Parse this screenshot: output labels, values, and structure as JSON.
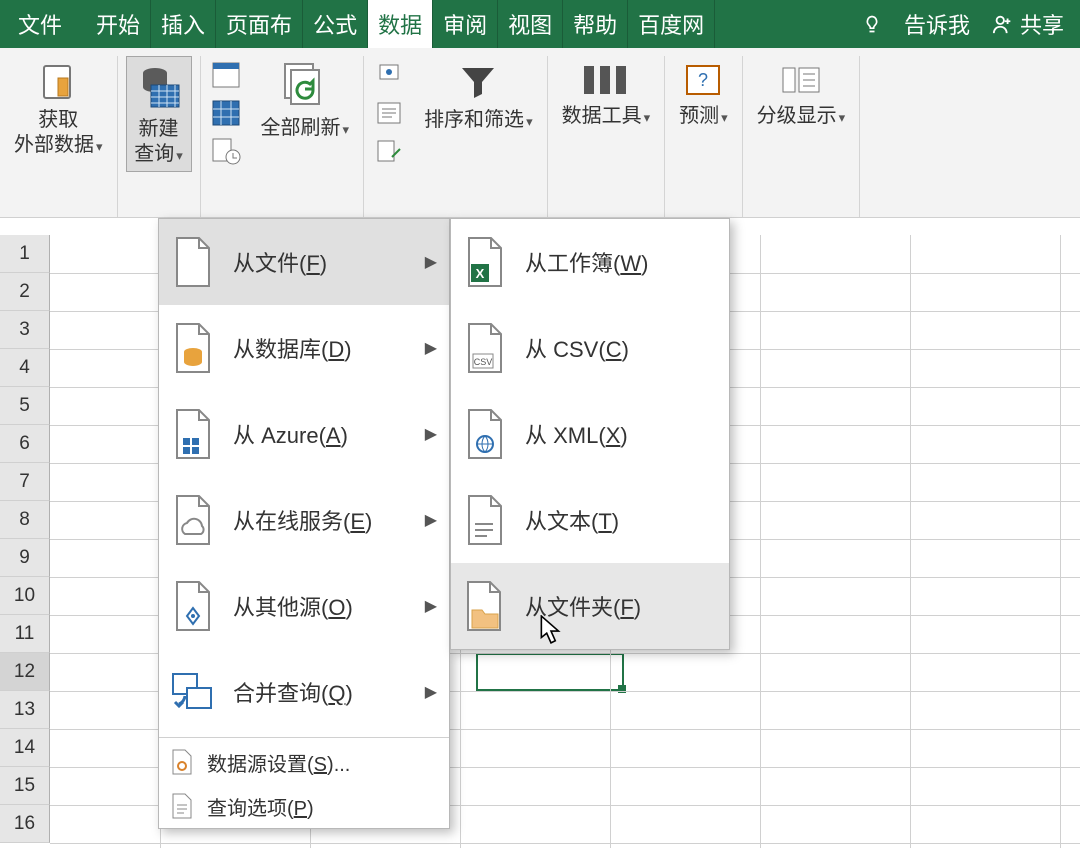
{
  "menubar": {
    "tabs": [
      "文件",
      "开始",
      "插入",
      "页面布",
      "公式",
      "数据",
      "审阅",
      "视图",
      "帮助",
      "百度网"
    ],
    "active_index": 5,
    "tell_me": "告诉我",
    "share": "共享"
  },
  "ribbon": {
    "get_external": {
      "line1": "获取",
      "line2": "外部数据"
    },
    "new_query": {
      "line1": "新建",
      "line2": "查询"
    },
    "refresh_all": "全部刷新",
    "sort_filter": "排序和筛选",
    "data_tools": "数据工具",
    "forecast": "预测",
    "outline": "分级显示"
  },
  "menu1": {
    "items": [
      {
        "label": "从文件",
        "accel": "F"
      },
      {
        "label": "从数据库",
        "accel": "D"
      },
      {
        "label": "从 Azure",
        "accel": "A"
      },
      {
        "label": "从在线服务",
        "accel": "E"
      },
      {
        "label": "从其他源",
        "accel": "O"
      },
      {
        "label": "合并查询",
        "accel": "Q"
      }
    ],
    "small_items": [
      {
        "label": "数据源设置",
        "accel": "S",
        "suffix": "..."
      },
      {
        "label": "查询选项",
        "accel": "P"
      }
    ]
  },
  "menu2": {
    "items": [
      {
        "label": "从工作簿",
        "accel": "W"
      },
      {
        "label": "从 CSV",
        "accel": "C"
      },
      {
        "label": "从 XML",
        "accel": "X"
      },
      {
        "label": "从文本",
        "accel": "T"
      },
      {
        "label": "从文件夹",
        "accel": "F"
      }
    ]
  },
  "rows": [
    "1",
    "2",
    "3",
    "4",
    "5",
    "6",
    "7",
    "8",
    "9",
    "10",
    "11",
    "12",
    "13",
    "14",
    "15",
    "16"
  ]
}
